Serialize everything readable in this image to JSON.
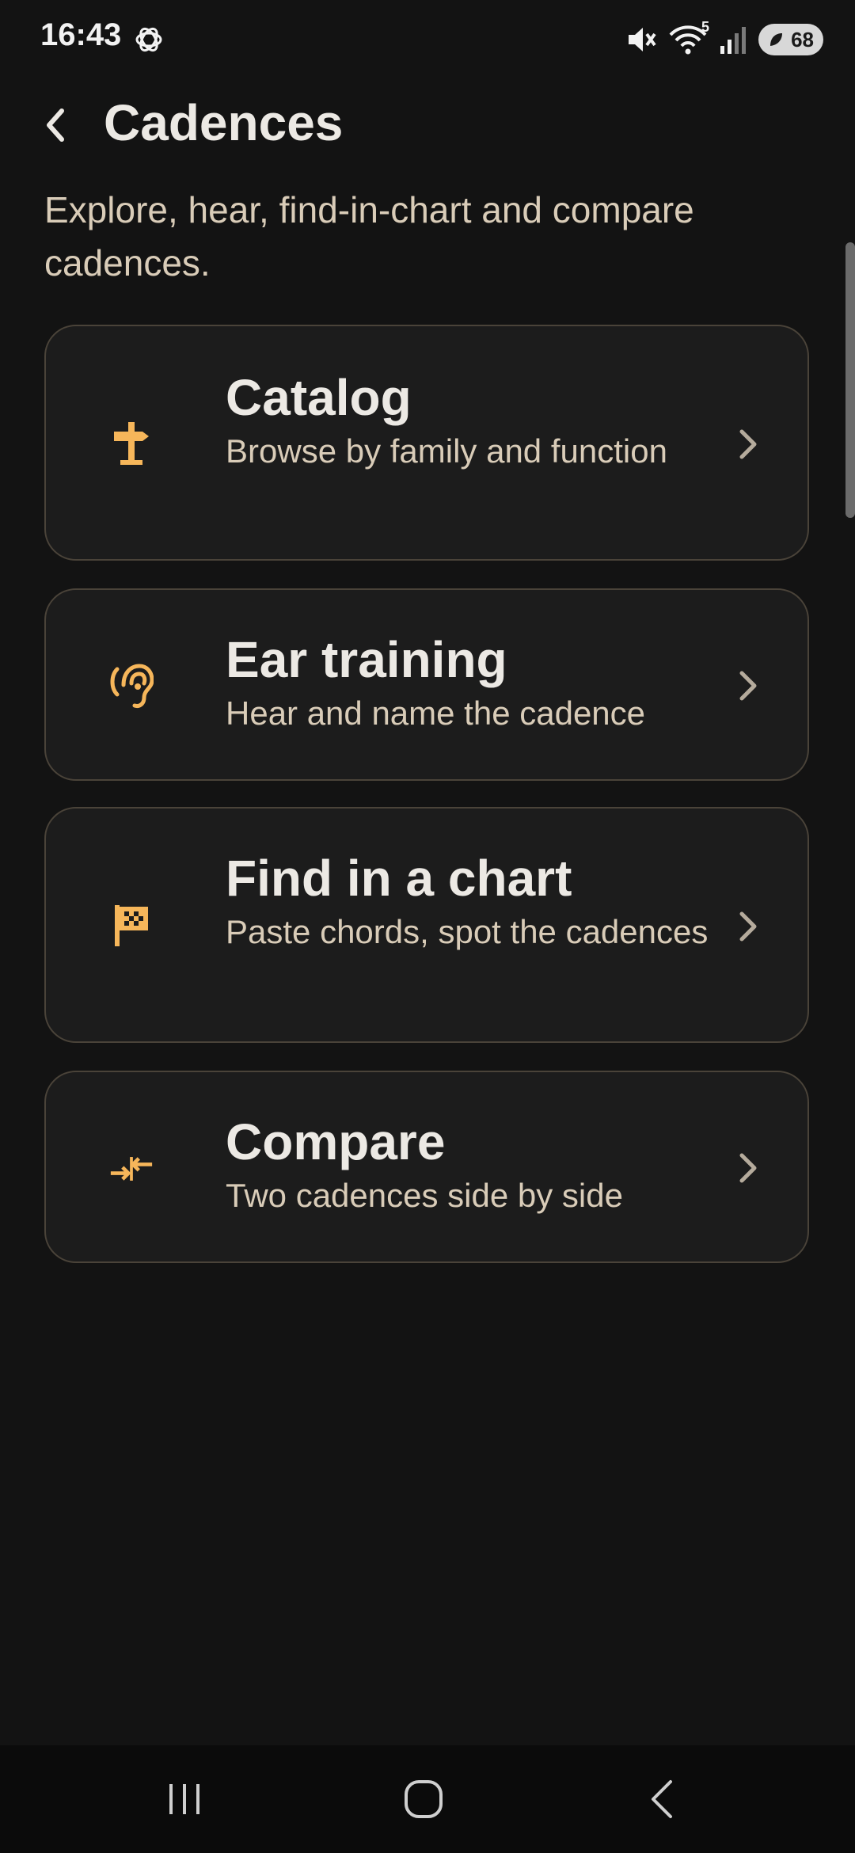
{
  "status_bar": {
    "time": "16:43",
    "battery": "68",
    "network_superscript": "5",
    "icons": [
      "chatgpt-icon",
      "mute-icon",
      "wifi-icon",
      "signal-icon",
      "battery-icon"
    ]
  },
  "header": {
    "title": "Cadences",
    "subtitle": "Explore, hear, find-in-chart and compare cadences."
  },
  "cards": [
    {
      "id": "catalog",
      "title": "Catalog",
      "description": "Browse by family and function",
      "icon": "signpost-icon"
    },
    {
      "id": "ear-training",
      "title": "Ear training",
      "description": "Hear and name the cadence",
      "icon": "ear-icon"
    },
    {
      "id": "find-in-chart",
      "title": "Find in a chart",
      "description": "Paste chords, spot the cadences",
      "icon": "checkered-flag-icon"
    },
    {
      "id": "compare",
      "title": "Compare",
      "description": "Two cadences side by side",
      "icon": "compare-arrows-icon"
    }
  ],
  "colors": {
    "background": "#131313",
    "card_background": "#1c1c1c",
    "card_border": "#4a4339",
    "accent": "#f6b65a",
    "text_primary": "#ece9e4",
    "text_secondary": "#d9ccb8"
  },
  "nav_bar": {
    "icons": [
      "recent-apps-icon",
      "home-icon",
      "back-icon"
    ]
  }
}
